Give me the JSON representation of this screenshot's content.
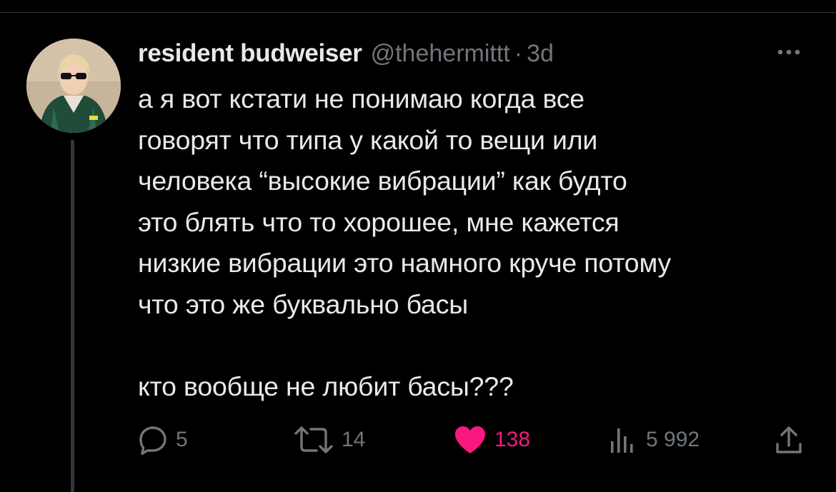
{
  "tweet": {
    "author": {
      "display_name": "resident budweiser",
      "handle": "@thehermittt",
      "separator": "·",
      "time": "3d"
    },
    "text": "а я вот кстати не понимаю когда все\nговорят что типа у какой то вещи или\nчеловека “высокие вибрации” как будто\nэто блять что то хорошее, мне кажется\nнизкие вибрации это намного круче потому\nчто это же буквально басы\n\nкто вообще не любит басы???",
    "actions": {
      "replies": "5",
      "reposts": "14",
      "likes": "138",
      "views": "5 992"
    },
    "liked": true
  },
  "icons": {
    "more": "more-horizontal-icon",
    "reply": "reply-icon",
    "repost": "repost-icon",
    "like": "heart-icon",
    "views": "views-icon",
    "share": "share-icon"
  },
  "colors": {
    "background": "#000000",
    "text": "#e7e9ea",
    "secondary_text": "#71767b",
    "like_accent": "#f91880",
    "thread_line": "#333639"
  }
}
